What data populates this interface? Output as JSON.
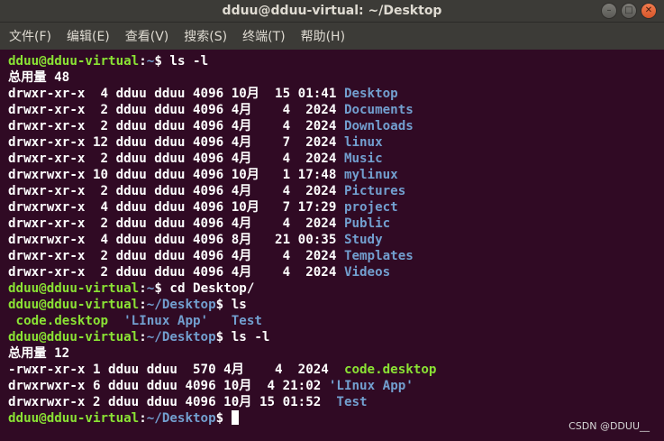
{
  "window": {
    "title": "dduu@dduu-virtual: ~/Desktop"
  },
  "menu": [
    "文件(F)",
    "编辑(E)",
    "查看(V)",
    "搜索(S)",
    "终端(T)",
    "帮助(H)"
  ],
  "colors": {
    "background": "#300a24",
    "prompt_user": "#8ae234",
    "directory": "#729fcf",
    "executable": "#8ae234",
    "titlebar": "#3c3b37"
  },
  "terminal": {
    "prompt_user": "dduu@dduu-virtual",
    "lines": [
      {
        "type": "prompt",
        "path": "~",
        "cmd": " ls -l"
      },
      {
        "type": "text",
        "text": "总用量 48"
      },
      {
        "type": "entry",
        "meta": "drwxr-xr-x  4 dduu dduu 4096 10月  15 01:41 ",
        "name": "Desktop",
        "kind": "dir"
      },
      {
        "type": "entry",
        "meta": "drwxr-xr-x  2 dduu dduu 4096 4月    4  2024 ",
        "name": "Documents",
        "kind": "dir"
      },
      {
        "type": "entry",
        "meta": "drwxr-xr-x  2 dduu dduu 4096 4月    4  2024 ",
        "name": "Downloads",
        "kind": "dir"
      },
      {
        "type": "entry",
        "meta": "drwxr-xr-x 12 dduu dduu 4096 4月    7  2024 ",
        "name": "linux",
        "kind": "dir"
      },
      {
        "type": "entry",
        "meta": "drwxr-xr-x  2 dduu dduu 4096 4月    4  2024 ",
        "name": "Music",
        "kind": "dir"
      },
      {
        "type": "entry",
        "meta": "drwxrwxr-x 10 dduu dduu 4096 10月   1 17:48 ",
        "name": "mylinux",
        "kind": "dir"
      },
      {
        "type": "entry",
        "meta": "drwxr-xr-x  2 dduu dduu 4096 4月    4  2024 ",
        "name": "Pictures",
        "kind": "dir"
      },
      {
        "type": "entry",
        "meta": "drwxrwxr-x  4 dduu dduu 4096 10月   7 17:29 ",
        "name": "project",
        "kind": "dir"
      },
      {
        "type": "entry",
        "meta": "drwxr-xr-x  2 dduu dduu 4096 4月    4  2024 ",
        "name": "Public",
        "kind": "dir"
      },
      {
        "type": "entry",
        "meta": "drwxrwxr-x  4 dduu dduu 4096 8月   21 00:35 ",
        "name": "Study",
        "kind": "dir"
      },
      {
        "type": "entry",
        "meta": "drwxr-xr-x  2 dduu dduu 4096 4月    4  2024 ",
        "name": "Templates",
        "kind": "dir"
      },
      {
        "type": "entry",
        "meta": "drwxr-xr-x  2 dduu dduu 4096 4月    4  2024 ",
        "name": "Videos",
        "kind": "dir"
      },
      {
        "type": "prompt",
        "path": "~",
        "cmd": " cd Desktop/"
      },
      {
        "type": "prompt",
        "path": "~/Desktop",
        "cmd": " ls"
      },
      {
        "type": "multi",
        "parts": [
          {
            "text": " ",
            "kind": "plain"
          },
          {
            "text": "code.desktop",
            "kind": "exec"
          },
          {
            "text": "  ",
            "kind": "plain"
          },
          {
            "text": "'LInux App'",
            "kind": "dir"
          },
          {
            "text": "   ",
            "kind": "plain"
          },
          {
            "text": "Test",
            "kind": "dir"
          }
        ]
      },
      {
        "type": "prompt",
        "path": "~/Desktop",
        "cmd": " ls -l"
      },
      {
        "type": "text",
        "text": "总用量 12"
      },
      {
        "type": "entry",
        "meta": "-rwxr-xr-x 1 dduu dduu  570 4月    4  2024  ",
        "name": "code.desktop",
        "kind": "exec"
      },
      {
        "type": "entry",
        "meta": "drwxrwxr-x 6 dduu dduu 4096 10月  4 21:02 ",
        "name": "'LInux App'",
        "kind": "dir"
      },
      {
        "type": "entry",
        "meta": "drwxrwxr-x 2 dduu dduu 4096 10月 15 01:52  ",
        "name": "Test",
        "kind": "dir"
      },
      {
        "type": "prompt",
        "path": "~/Desktop",
        "cmd": " ",
        "cursor": true
      }
    ]
  },
  "watermark": "CSDN @DDUU__"
}
